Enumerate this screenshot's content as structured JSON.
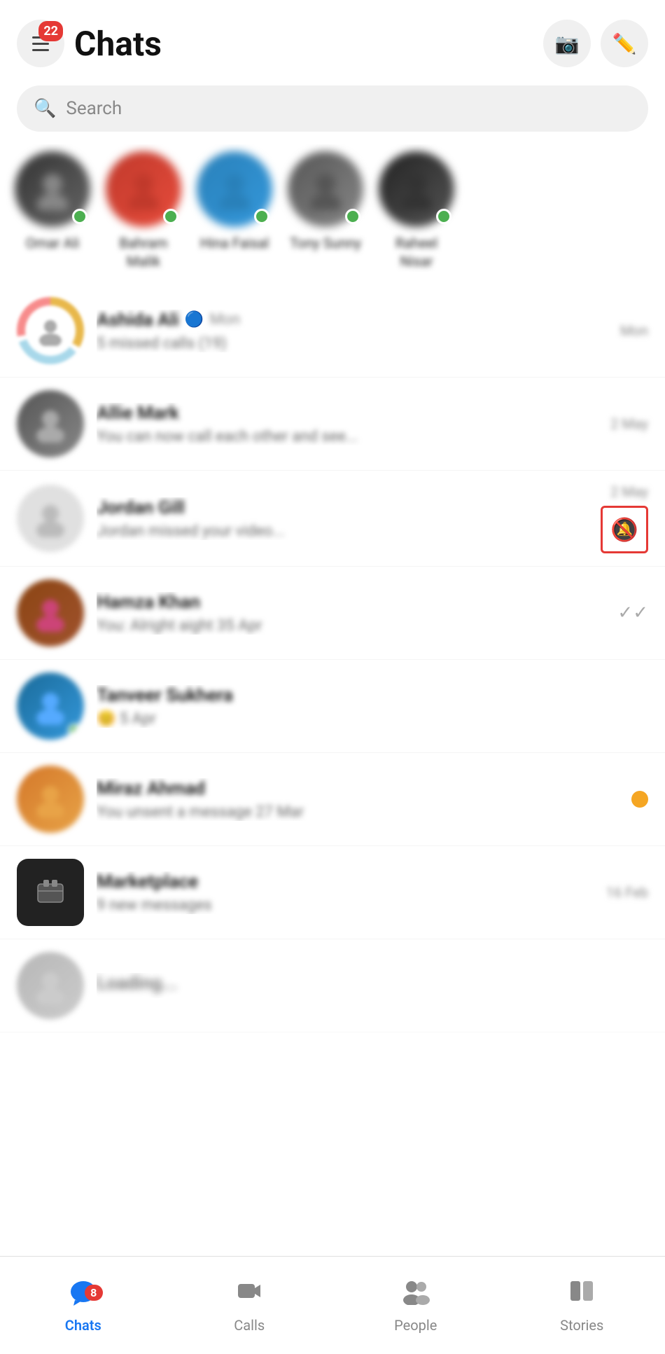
{
  "header": {
    "title": "Chats",
    "menu_badge": "22",
    "camera_icon": "📷",
    "compose_icon": "✏️"
  },
  "search": {
    "placeholder": "Search"
  },
  "stories": [
    {
      "name": "Omar Ali",
      "color": "av1",
      "online": true
    },
    {
      "name": "Bahram Malik",
      "color": "av2",
      "online": true
    },
    {
      "name": "Hina Faisal",
      "color": "av3",
      "online": true
    },
    {
      "name": "Tony Sunny",
      "color": "av4",
      "online": true
    },
    {
      "name": "Raheel Nisar",
      "color": "av5",
      "online": true
    }
  ],
  "chats": [
    {
      "name": "Ashida Ali 🔵 Mon",
      "preview": "5 missed calls (19)",
      "time": "Mon",
      "type": "group",
      "verified": true
    },
    {
      "name": "Allie Mark",
      "preview": "You can now call each other and see...",
      "time": "2 May",
      "type": "normal"
    },
    {
      "name": "Jordan Gill",
      "preview": "Jordan missed your video...",
      "time": "2 May",
      "type": "normal",
      "muted": true
    },
    {
      "name": "Hamza Khan",
      "preview": "You: Alright aight 35 Apr",
      "time": "",
      "type": "normal",
      "seen": true
    },
    {
      "name": "Tanveer Sukhera",
      "preview": "😊 5 Apr",
      "time": "",
      "type": "normal",
      "online": true
    },
    {
      "name": "Miraz Ahmad",
      "preview": "You unsent a message  27 Mar",
      "time": "",
      "type": "normal",
      "unread_dot": true
    },
    {
      "name": "Marketplace",
      "preview": "9 new messages",
      "time": "16 Feb",
      "type": "marketplace"
    }
  ],
  "partial_chat": {
    "name": "...",
    "preview": ""
  },
  "bottom_nav": {
    "items": [
      {
        "label": "Chats",
        "active": true,
        "badge": "8"
      },
      {
        "label": "Calls",
        "active": false
      },
      {
        "label": "People",
        "active": false
      },
      {
        "label": "Stories",
        "active": false
      }
    ]
  }
}
